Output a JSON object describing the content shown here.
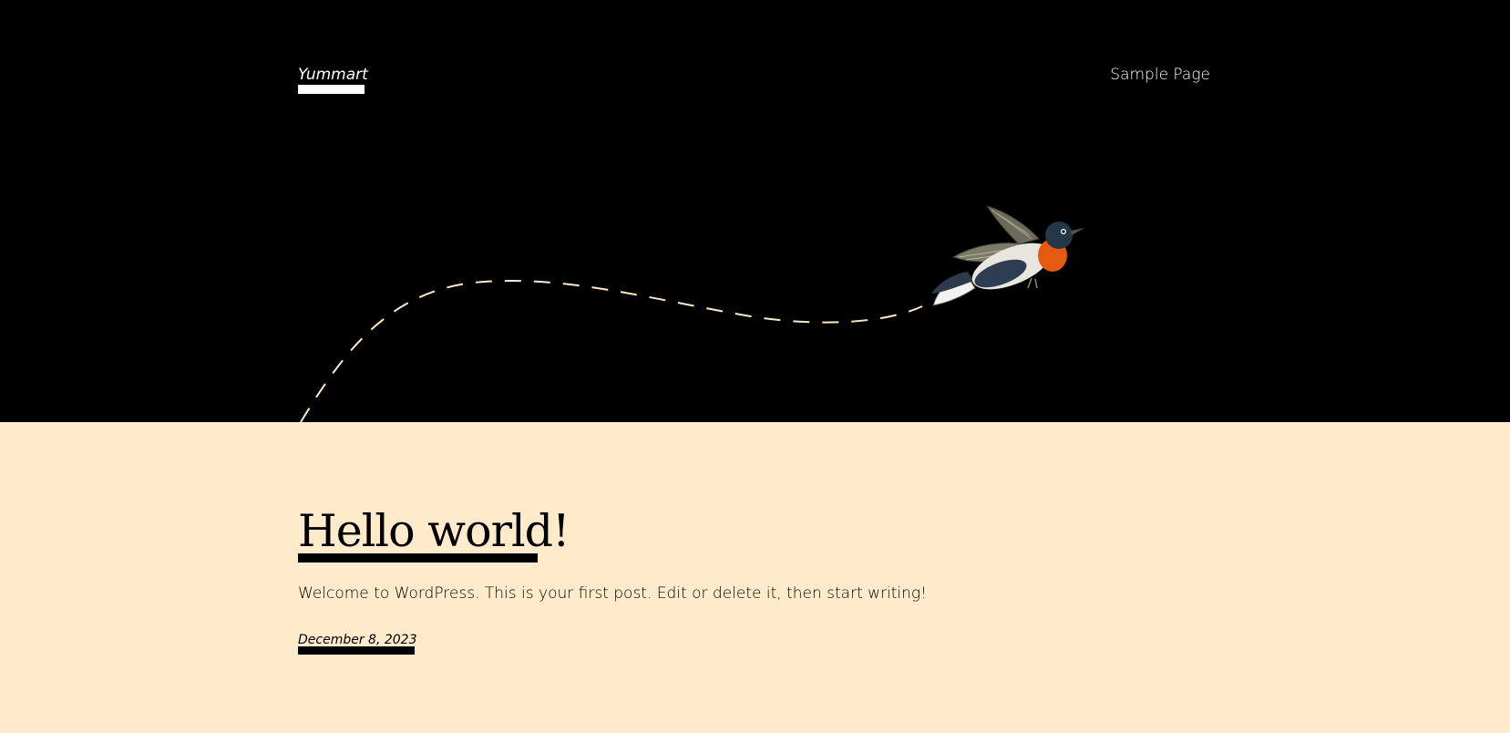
{
  "header": {
    "site_title": "Yummart",
    "nav": [
      {
        "label": "Sample Page"
      }
    ],
    "background_color": "#000000",
    "flight_path_color": "#ffe8c6",
    "illustration": "flying-bird-icon"
  },
  "main": {
    "background_color": "#ffebcc",
    "posts": [
      {
        "title": "Hello world!",
        "excerpt": "Welcome to WordPress. This is your first post. Edit or delete it, then start writing!",
        "date": "December 8, 2023"
      }
    ]
  }
}
